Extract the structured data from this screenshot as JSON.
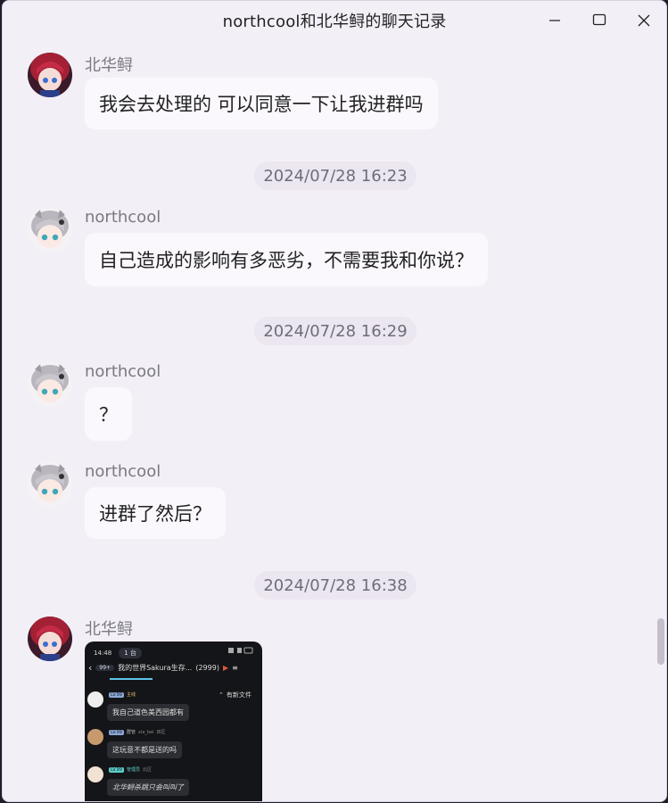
{
  "window": {
    "title": "northcool和北华鲟的聊天记录"
  },
  "messages": [
    {
      "sender": "北华鲟",
      "text": "我会去处理的 可以同意一下让我进群吗"
    },
    {
      "time": "2024/07/28 16:23"
    },
    {
      "sender": "northcool",
      "text": "自己造成的影响有多恶劣，不需要我和你说？"
    },
    {
      "time": "2024/07/28 16:29"
    },
    {
      "sender": "northcool",
      "text": "？"
    },
    {
      "sender": "northcool",
      "text": "进群了然后？"
    },
    {
      "time": "2024/07/28 16:38"
    },
    {
      "sender": "北华鲟",
      "image": {
        "status_time": "14:48",
        "status_badge": "1 台",
        "back_count": "99+",
        "group_name": "我的世界Sakura生存...",
        "member_count": "(2999)",
        "new_file": "有新文件",
        "chat": [
          {
            "tag": "LV.99",
            "name": "主线",
            "text": "我自己道色美西园都有"
          },
          {
            "tag": "LV.99",
            "name": "群管",
            "sub": "xia_bei",
            "extra": "四区",
            "text": "这玩意不都是送的吗"
          },
          {
            "tag": "LV.99",
            "name": "管理员",
            "sub": "北区",
            "text": "北华鲟杀跳只会叫叫了"
          }
        ]
      }
    }
  ],
  "colors": {
    "window_bg": "#f3eff7",
    "bubble_bg": "#fbf8fd",
    "time_pill_bg": "#ebe6f0"
  }
}
